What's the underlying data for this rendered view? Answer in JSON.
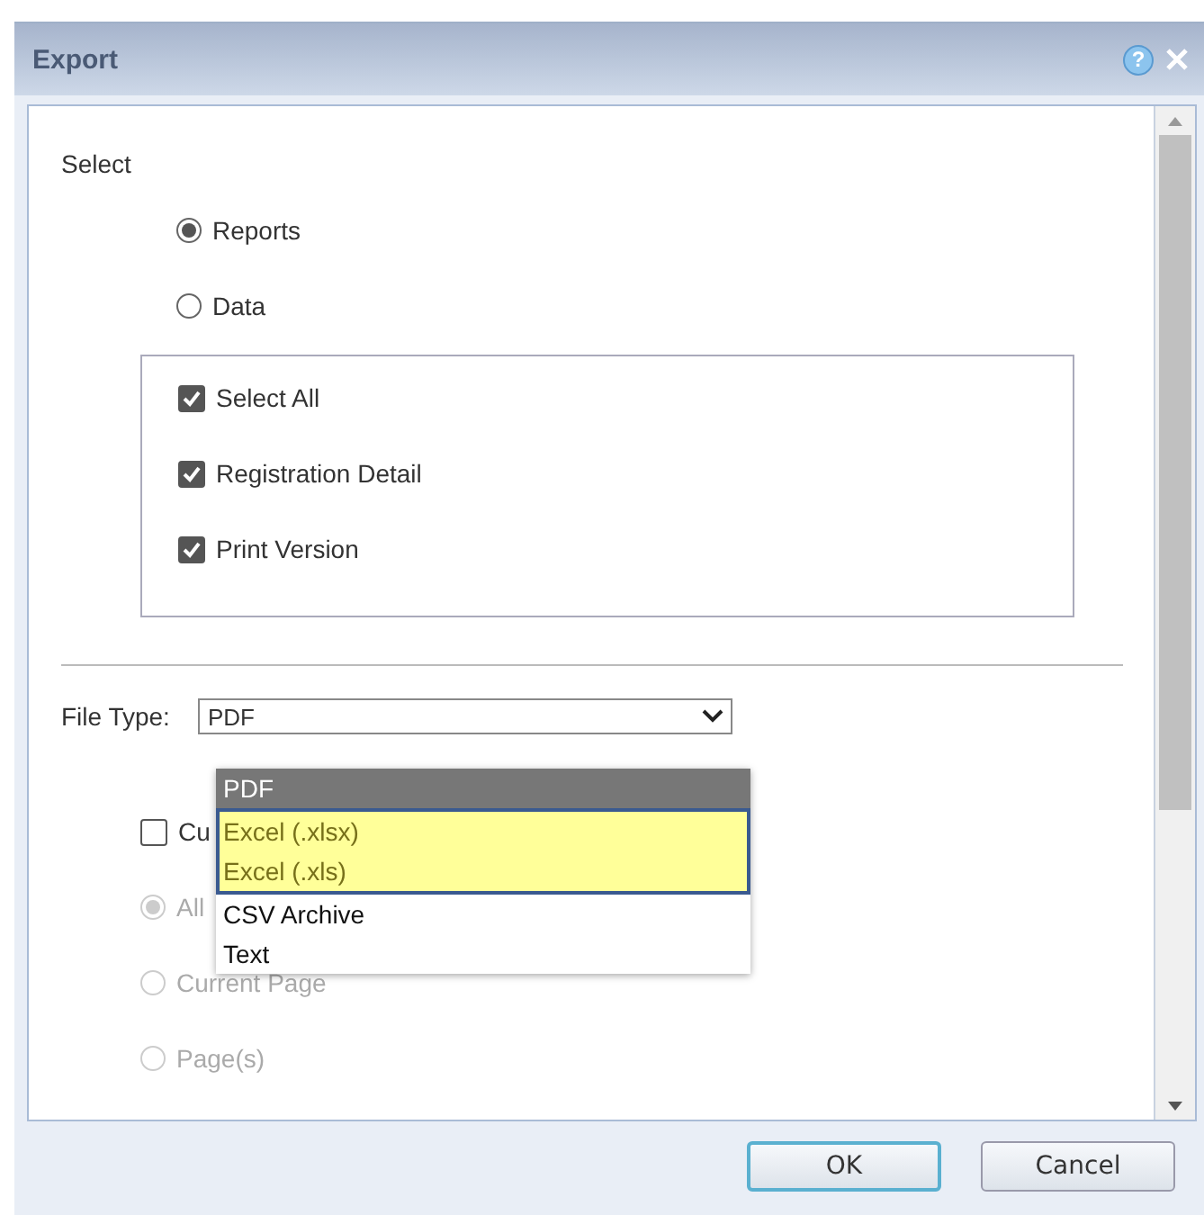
{
  "dialog": {
    "title": "Export",
    "help": "?"
  },
  "select": {
    "label": "Select",
    "options": [
      {
        "label": "Reports",
        "selected": true
      },
      {
        "label": "Data",
        "selected": false
      }
    ],
    "items": [
      {
        "label": "Select All",
        "checked": true
      },
      {
        "label": "Registration Detail",
        "checked": true
      },
      {
        "label": "Print Version",
        "checked": true
      }
    ]
  },
  "file_type": {
    "label": "File Type:",
    "value": "PDF",
    "options": [
      {
        "label": "PDF",
        "selected": true,
        "highlighted": false
      },
      {
        "label": "Excel (.xlsx)",
        "selected": false,
        "highlighted": true
      },
      {
        "label": "Excel (.xls)",
        "selected": false,
        "highlighted": true
      },
      {
        "label": "CSV Archive",
        "selected": false,
        "highlighted": false
      },
      {
        "label": "Text",
        "selected": false,
        "highlighted": false
      }
    ]
  },
  "custom": {
    "label": "Cu",
    "checked": false
  },
  "pages": [
    {
      "label": "All",
      "selected": true,
      "disabled": true
    },
    {
      "label": "Current Page",
      "selected": false,
      "disabled": true
    },
    {
      "label": "Page(s)",
      "selected": false,
      "disabled": true
    }
  ],
  "buttons": [
    {
      "label": "OK",
      "kind": "primary"
    },
    {
      "label": "Cancel",
      "kind": "secondary"
    }
  ]
}
